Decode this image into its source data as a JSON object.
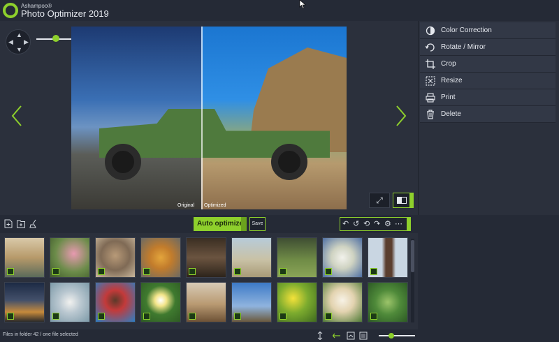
{
  "app": {
    "brand_small": "Ashampoo®",
    "title": "Photo Optimizer 2019"
  },
  "colors": {
    "accent": "#8ed02c",
    "background": "#252a36",
    "panel": "#2b303c"
  },
  "viewer": {
    "label_original": "Original",
    "label_optimized": "Optimized"
  },
  "sidepanel": {
    "items": [
      {
        "label": "Color Correction",
        "icon": "color-correction-icon"
      },
      {
        "label": "Rotate / Mirror",
        "icon": "rotate-icon"
      },
      {
        "label": "Crop",
        "icon": "crop-icon"
      },
      {
        "label": "Resize",
        "icon": "resize-icon"
      },
      {
        "label": "Print",
        "icon": "print-icon"
      },
      {
        "label": "Delete",
        "icon": "trash-icon"
      }
    ]
  },
  "toolbar": {
    "auto_optimize_label": "Auto optimize",
    "save_label": "Save"
  },
  "thumbnails": [
    {
      "subject": "seaside town"
    },
    {
      "subject": "flamingo"
    },
    {
      "subject": "monkey"
    },
    {
      "subject": "figure statue"
    },
    {
      "subject": "bowl"
    },
    {
      "subject": "lizard on beach"
    },
    {
      "subject": "bird on grass"
    },
    {
      "subject": "white blossoms"
    },
    {
      "subject": "church tower"
    },
    {
      "subject": "city at night"
    },
    {
      "subject": "white heron"
    },
    {
      "subject": "woman portrait"
    },
    {
      "subject": "daisy"
    },
    {
      "subject": "desert sunset"
    },
    {
      "subject": "eiffel tower"
    },
    {
      "subject": "yellow flowers"
    },
    {
      "subject": "white dog"
    },
    {
      "subject": "green plant"
    }
  ],
  "statusbar": {
    "text": "Files in folder 42 / one file selected"
  }
}
